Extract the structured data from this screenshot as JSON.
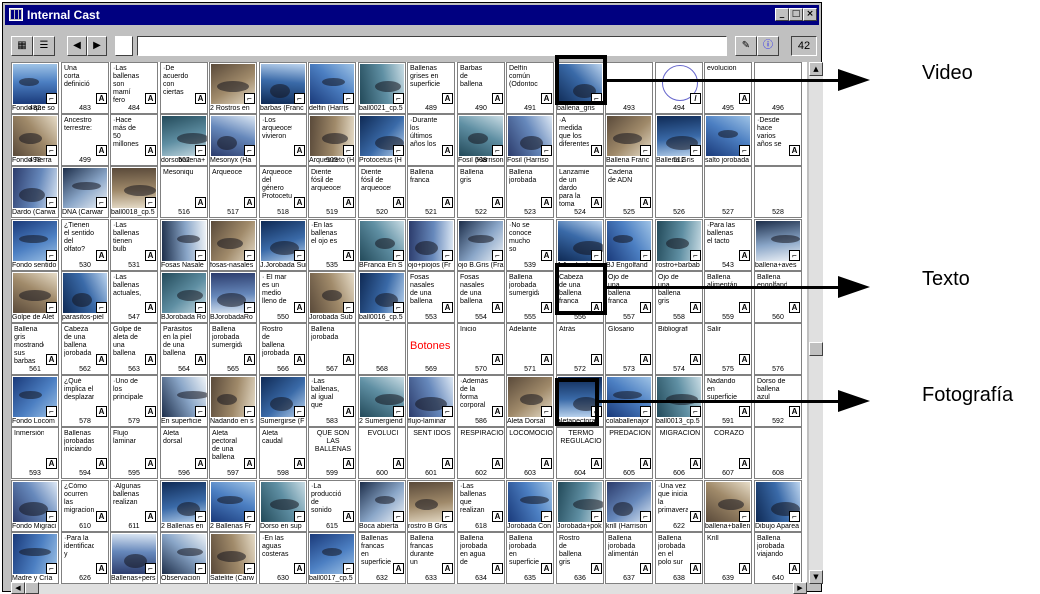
{
  "window": {
    "title": "Internal Cast"
  },
  "toolbar": {
    "count": "42"
  },
  "callouts": [
    {
      "label": "Video"
    },
    {
      "label": "Texto"
    },
    {
      "label": "Fotografía"
    }
  ],
  "cells": [
    {
      "name": "Fondo que so",
      "text": "",
      "kind": "img"
    },
    {
      "name": "",
      "text": "Una corta definició",
      "kind": "txt"
    },
    {
      "name": "",
      "text": "·Las ballenas son mamí fero",
      "kind": "txt"
    },
    {
      "name": "",
      "text": "·De acuerdo con ciertas",
      "kind": "txt"
    },
    {
      "name": "2 Rostros en",
      "text": "",
      "kind": "img"
    },
    {
      "name": "barbas (Franc",
      "text": "",
      "kind": "img"
    },
    {
      "name": "delfin (Harris",
      "text": "",
      "kind": "img"
    },
    {
      "name": "ball0021_cp.5",
      "text": "",
      "kind": "img"
    },
    {
      "name": "",
      "text": "Ballenas grises en superficie",
      "kind": "txt"
    },
    {
      "name": "",
      "text": "Barbas de ballena",
      "kind": "txt"
    },
    {
      "name": "",
      "text": "Delfín común (Odontoc",
      "kind": "txt"
    },
    {
      "name": "ballena_gris",
      "text": "",
      "kind": "img"
    },
    {
      "name": "",
      "text": "",
      "kind": "blank"
    },
    {
      "name": "",
      "text": "",
      "kind": "circle"
    },
    {
      "name": "",
      "text": "evolucion",
      "kind": "txt"
    },
    {
      "name": "",
      "text": "",
      "kind": "blank"
    },
    {
      "name": "Fondo Tierra",
      "text": "",
      "kind": "img"
    },
    {
      "name": "",
      "text": "Ancestro terrestre:",
      "kind": "txt"
    },
    {
      "name": "",
      "text": "·Hace más de 50 millones",
      "kind": "txt"
    },
    {
      "name": "dorsoballena+",
      "text": "",
      "kind": "img"
    },
    {
      "name": "Mesonyx (Ha",
      "text": "",
      "kind": "img"
    },
    {
      "name": "",
      "text": "·Los arqueocetos vivieron",
      "kind": "txt"
    },
    {
      "name": "Arqueoceto (H",
      "text": "",
      "kind": "img"
    },
    {
      "name": "Protocetus (H",
      "text": "",
      "kind": "img"
    },
    {
      "name": "",
      "text": "·Durante los últimos años los",
      "kind": "txt"
    },
    {
      "name": "Fosil (Harrison",
      "text": "",
      "kind": "img"
    },
    {
      "name": "Fosil (Harriso",
      "text": "",
      "kind": "img"
    },
    {
      "name": "",
      "text": "·A medida que los diferentes",
      "kind": "txt"
    },
    {
      "name": "Ballena Franc",
      "text": "",
      "kind": "img"
    },
    {
      "name": "Ballena Gris",
      "text": "",
      "kind": "img"
    },
    {
      "name": "salto jorobada",
      "text": "",
      "kind": "img"
    },
    {
      "name": "",
      "text": "·Desde hace varios años se",
      "kind": "txt"
    },
    {
      "name": "Dardo (Carwa",
      "text": "",
      "kind": "img"
    },
    {
      "name": "DNA (Carwar",
      "text": "",
      "kind": "img"
    },
    {
      "name": "ball0018_cp.5",
      "text": "",
      "kind": "img"
    },
    {
      "name": "",
      "text": "Mesoniquiano",
      "kind": "txt"
    },
    {
      "name": "",
      "text": "Arqueoceto",
      "kind": "txt"
    },
    {
      "name": "",
      "text": "Arqueoceto del género Protocetus",
      "kind": "txt"
    },
    {
      "name": "",
      "text": "Diente fósil de arqueocet",
      "kind": "txt"
    },
    {
      "name": "",
      "text": "Diente fósil de arqueocet",
      "kind": "txt"
    },
    {
      "name": "",
      "text": "Ballena franca",
      "kind": "txt"
    },
    {
      "name": "",
      "text": "Ballena gris",
      "kind": "txt"
    },
    {
      "name": "",
      "text": "Ballena jorobada",
      "kind": "txt"
    },
    {
      "name": "",
      "text": "Lanzamiento de un dardo para la toma",
      "kind": "txt"
    },
    {
      "name": "",
      "text": "Cadena de ADN",
      "kind": "txt"
    },
    {
      "name": "",
      "text": "",
      "kind": "blank"
    },
    {
      "name": "",
      "text": "",
      "kind": "blank"
    },
    {
      "name": "",
      "text": "",
      "kind": "blank"
    },
    {
      "name": "Fondo sentido",
      "text": "",
      "kind": "img"
    },
    {
      "name": "",
      "text": "¿Tienen el sentido del olfato?",
      "kind": "txt"
    },
    {
      "name": "",
      "text": "·Las ballenas tienen bulb",
      "kind": "txt"
    },
    {
      "name": "Fosas Nasale",
      "text": "",
      "kind": "img"
    },
    {
      "name": "fosas-nasales",
      "text": "",
      "kind": "img"
    },
    {
      "name": "J.Jorobada Sur",
      "text": "",
      "kind": "img"
    },
    {
      "name": "",
      "text": "·En las ballenas el ojo es",
      "kind": "txt"
    },
    {
      "name": "BFranca En S",
      "text": "",
      "kind": "img"
    },
    {
      "name": "ojo+piojos (Fr",
      "text": "",
      "kind": "img"
    },
    {
      "name": "ojo B.Gris (Fra",
      "text": "",
      "kind": "img"
    },
    {
      "name": "",
      "text": "·No se conoce mucho so",
      "kind": "txt"
    },
    {
      "name": "J.Jorobada",
      "text": "",
      "kind": "img"
    },
    {
      "name": "BJ Engolfand",
      "text": "",
      "kind": "img"
    },
    {
      "name": "rostro+barbab",
      "text": "",
      "kind": "img"
    },
    {
      "name": "",
      "text": "·Para las ballenas el tacto",
      "kind": "txt"
    },
    {
      "name": "ballena+aves",
      "text": "",
      "kind": "img"
    },
    {
      "name": "Golpe de Alet",
      "text": "",
      "kind": "img"
    },
    {
      "name": "parasitos-piel",
      "text": "",
      "kind": "img"
    },
    {
      "name": "",
      "text": "·Las ballenas actuales,",
      "kind": "txt"
    },
    {
      "name": "BJorobada Ro",
      "text": "",
      "kind": "img"
    },
    {
      "name": "BJorobadaRo",
      "text": "",
      "kind": "img"
    },
    {
      "name": "",
      "text": "· El mar es un medio lleno de",
      "kind": "txt"
    },
    {
      "name": "Jorobada Sub",
      "text": "",
      "kind": "img"
    },
    {
      "name": "ball0016_cp.5",
      "text": "",
      "kind": "img"
    },
    {
      "name": "",
      "text": "Fosas nasales de una ballena",
      "kind": "txt"
    },
    {
      "name": "",
      "text": "Fosas nasales de una ballena",
      "kind": "txt"
    },
    {
      "name": "",
      "text": "Ballena jorobada sumergida",
      "kind": "txt"
    },
    {
      "name": "",
      "text": "Cabeza de una ballena franca",
      "kind": "txt"
    },
    {
      "name": "",
      "text": "Ojo de una ballena franca",
      "kind": "txt"
    },
    {
      "name": "",
      "text": "Ojo de una ballena gris",
      "kind": "txt"
    },
    {
      "name": "",
      "text": "Ballena alimentándose",
      "kind": "txt"
    },
    {
      "name": "",
      "text": "Ballena engolfando",
      "kind": "txt"
    },
    {
      "name": "",
      "text": "Ballena gris mostrando sus barbas",
      "kind": "txt"
    },
    {
      "name": "",
      "text": "Cabeza de una ballena jorobada",
      "kind": "txt"
    },
    {
      "name": "",
      "text": "Golpe de aleta de una ballena",
      "kind": "txt"
    },
    {
      "name": "",
      "text": "Parásitos en la piel de una ballena",
      "kind": "txt"
    },
    {
      "name": "",
      "text": "Ballena jorobada sumergida",
      "kind": "txt"
    },
    {
      "name": "",
      "text": "Rostro de ballena jorobada",
      "kind": "txt"
    },
    {
      "name": "",
      "text": "Ballena jorobada",
      "kind": "txt"
    },
    {
      "name": "",
      "text": "",
      "kind": "blank"
    },
    {
      "name": "",
      "text": "Botones",
      "kind": "red"
    },
    {
      "name": "",
      "text": "Inicio",
      "kind": "txt"
    },
    {
      "name": "",
      "text": "Adelante",
      "kind": "txt"
    },
    {
      "name": "",
      "text": "Atrás",
      "kind": "txt"
    },
    {
      "name": "",
      "text": "Glosario",
      "kind": "txt"
    },
    {
      "name": "",
      "text": "Bibliografía",
      "kind": "txt"
    },
    {
      "name": "",
      "text": "Salir",
      "kind": "txt"
    },
    {
      "name": "",
      "text": "",
      "kind": "blank"
    },
    {
      "name": "Fondo Locom",
      "text": "",
      "kind": "img"
    },
    {
      "name": "",
      "text": "¿Qué implica el desplazar",
      "kind": "txt"
    },
    {
      "name": "",
      "text": "·Uno de los principales",
      "kind": "txt"
    },
    {
      "name": "En superficie",
      "text": "",
      "kind": "img"
    },
    {
      "name": "Nadando en s",
      "text": "",
      "kind": "img"
    },
    {
      "name": "Sumergirse (F",
      "text": "",
      "kind": "img"
    },
    {
      "name": "",
      "text": "·Las ballenas, al igual que",
      "kind": "txt"
    },
    {
      "name": "2 Sumergiend",
      "text": "",
      "kind": "img"
    },
    {
      "name": "flujo-laminar",
      "text": "",
      "kind": "img"
    },
    {
      "name": "",
      "text": "·Además de la forma corporal",
      "kind": "txt"
    },
    {
      "name": "Aleta Dorsal",
      "text": "",
      "kind": "img"
    },
    {
      "name": "aletapectoral",
      "text": "",
      "kind": "img"
    },
    {
      "name": "colaballenajor",
      "text": "",
      "kind": "img"
    },
    {
      "name": "ball0013_cp.5",
      "text": "",
      "kind": "img"
    },
    {
      "name": "",
      "text": "Nadando en superficie",
      "kind": "txt"
    },
    {
      "name": "",
      "text": "Dorso de ballena azul",
      "kind": "txt"
    },
    {
      "name": "",
      "text": "Inmersión",
      "kind": "txt"
    },
    {
      "name": "",
      "text": "Ballenas jorobadas iniciando",
      "kind": "txt"
    },
    {
      "name": "",
      "text": "Flujo laminar",
      "kind": "txt"
    },
    {
      "name": "",
      "text": "Aleta dorsal",
      "kind": "txt"
    },
    {
      "name": "",
      "text": "Aleta pectoral de una ballena",
      "kind": "txt"
    },
    {
      "name": "",
      "text": "Aleta caudal",
      "kind": "txt"
    },
    {
      "name": "",
      "text": "QUE SON LAS BALLENAS",
      "kind": "ctr"
    },
    {
      "name": "",
      "text": "EVOLUCI",
      "kind": "ctr"
    },
    {
      "name": "",
      "text": "SENT IDOS",
      "kind": "ctr"
    },
    {
      "name": "",
      "text": "RESPIRACIÓ",
      "kind": "ctr"
    },
    {
      "name": "",
      "text": "LOCOMOCIÓ",
      "kind": "ctr"
    },
    {
      "name": "",
      "text": "TERMO REGULACIO",
      "kind": "ctr"
    },
    {
      "name": "",
      "text": "PREDACIÓN",
      "kind": "ctr"
    },
    {
      "name": "",
      "text": "MIGRACION",
      "kind": "ctr"
    },
    {
      "name": "",
      "text": "CORAZÓ",
      "kind": "ctr"
    },
    {
      "name": "",
      "text": "",
      "kind": "blank"
    },
    {
      "name": "Fondo Migraci",
      "text": "",
      "kind": "img"
    },
    {
      "name": "",
      "text": "¿Cómo ocurren las migracion",
      "kind": "txt"
    },
    {
      "name": "",
      "text": "·Algunas ballenas realizan",
      "kind": "txt"
    },
    {
      "name": "2 Ballenas en",
      "text": "",
      "kind": "img"
    },
    {
      "name": "2 Ballenas Fr",
      "text": "",
      "kind": "img"
    },
    {
      "name": "Dorso en sup",
      "text": "",
      "kind": "img"
    },
    {
      "name": "",
      "text": "·La producción de sonido",
      "kind": "txt"
    },
    {
      "name": "Boca abierta",
      "text": "",
      "kind": "img"
    },
    {
      "name": "rostro B Gris",
      "text": "",
      "kind": "img"
    },
    {
      "name": "",
      "text": "·Las ballenas que realizan",
      "kind": "txt"
    },
    {
      "name": "Jorobada Con",
      "text": "",
      "kind": "img"
    },
    {
      "name": "Jorobada+pok",
      "text": "",
      "kind": "img"
    },
    {
      "name": "krill (Harrison",
      "text": "",
      "kind": "img"
    },
    {
      "name": "",
      "text": "·Una vez que inicia la primavera",
      "kind": "txt"
    },
    {
      "name": "ballena+ballen",
      "text": "",
      "kind": "img"
    },
    {
      "name": "Dibujo Aparea",
      "text": "",
      "kind": "img"
    },
    {
      "name": "Madre y Cría",
      "text": "",
      "kind": "img"
    },
    {
      "name": "",
      "text": "·Para la identificación y",
      "kind": "txt"
    },
    {
      "name": "Ballenas+pers",
      "text": "",
      "kind": "img"
    },
    {
      "name": "Observacion",
      "text": "",
      "kind": "img"
    },
    {
      "name": "Satelite (Carw",
      "text": "",
      "kind": "img"
    },
    {
      "name": "",
      "text": "·En las aguas costeras",
      "kind": "txt"
    },
    {
      "name": "ball0017_cp.5",
      "text": "",
      "kind": "img"
    },
    {
      "name": "",
      "text": "Ballenas francas en superficie",
      "kind": "txt"
    },
    {
      "name": "",
      "text": "Ballena francas durante un",
      "kind": "txt"
    },
    {
      "name": "",
      "text": "Ballena jorobada en agua de",
      "kind": "txt"
    },
    {
      "name": "",
      "text": "Ballena jorobada en superficie",
      "kind": "txt"
    },
    {
      "name": "",
      "text": "Rostro de ballena gris",
      "kind": "txt"
    },
    {
      "name": "",
      "text": "Ballena jorobada alimentándose",
      "kind": "txt"
    },
    {
      "name": "",
      "text": "Ballena jorobada en el polo sur",
      "kind": "txt"
    },
    {
      "name": "",
      "text": "Krill",
      "kind": "txt"
    },
    {
      "name": "",
      "text": "Ballena jorobada viajando",
      "kind": "txt"
    }
  ],
  "row_numbers": [
    [
      "482",
      "483",
      "484",
      "",
      "",
      "",
      "",
      "",
      "489",
      "490",
      "491",
      "",
      "493",
      "494",
      "495",
      "496"
    ],
    [
      "498",
      "499",
      "",
      "502",
      "",
      "",
      "505",
      "",
      "",
      "508",
      "",
      "",
      "",
      "512",
      "",
      ""
    ],
    [
      "",
      "",
      "",
      "516",
      "517",
      "518",
      "519",
      "520",
      "521",
      "522",
      "523",
      "524",
      "525",
      "526",
      "527",
      "528"
    ],
    [
      "",
      "530",
      "531",
      "",
      "",
      "",
      "535",
      "",
      "",
      "",
      "539",
      "",
      "",
      "",
      "543",
      ""
    ],
    [
      "",
      "",
      "547",
      "",
      "",
      "550",
      "",
      "",
      "553",
      "554",
      "555",
      "556",
      "557",
      "558",
      "559",
      "560"
    ],
    [
      "561",
      "562",
      "563",
      "564",
      "565",
      "566",
      "567",
      "568",
      "569",
      "570",
      "571",
      "572",
      "573",
      "574",
      "575",
      "576"
    ],
    [
      "",
      "578",
      "579",
      "",
      "",
      "",
      "583",
      "",
      "",
      "586",
      "",
      "",
      "",
      "",
      "591",
      "592"
    ],
    [
      "593",
      "594",
      "595",
      "596",
      "597",
      "598",
      "599",
      "600",
      "601",
      "602",
      "603",
      "604",
      "605",
      "606",
      "607",
      "608"
    ],
    [
      "",
      "610",
      "611",
      "",
      "",
      "",
      "615",
      "",
      "",
      "618",
      "",
      "",
      "",
      "622",
      "",
      ""
    ],
    [
      "",
      "626",
      "",
      "",
      "",
      "630",
      "",
      "632",
      "633",
      "634",
      "635",
      "636",
      "637",
      "638",
      "639",
      "640"
    ]
  ],
  "colors": {
    "title_bar": "#000080",
    "chrome": "#c0c0c0",
    "red_text": "#ff0000"
  }
}
